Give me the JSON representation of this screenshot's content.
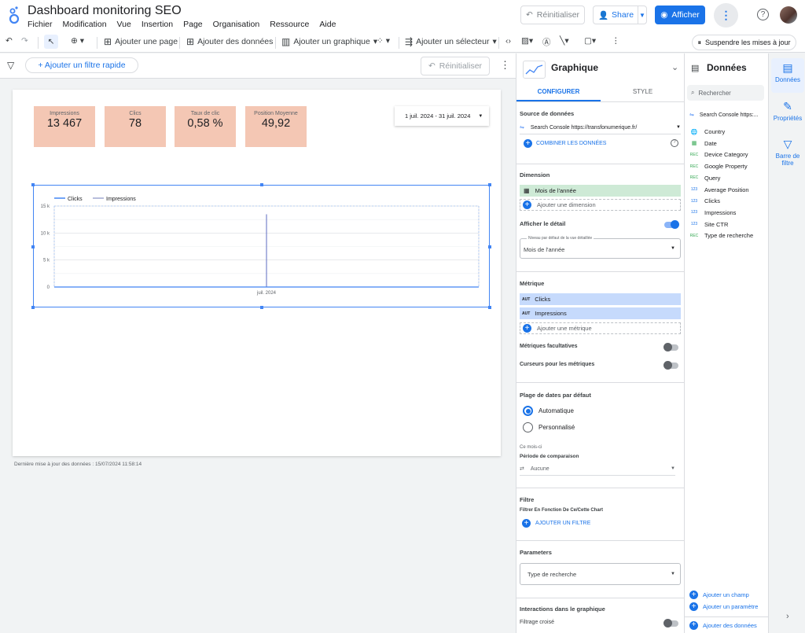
{
  "app": {
    "title": "Dashboard monitoring SEO",
    "menu": [
      "Fichier",
      "Modification",
      "Vue",
      "Insertion",
      "Page",
      "Organisation",
      "Ressource",
      "Aide"
    ]
  },
  "header": {
    "reset": "Réinitialiser",
    "share": "Share",
    "view": "Afficher"
  },
  "toolbar": {
    "add_page": "Ajouter une page",
    "add_data": "Ajouter des données",
    "add_chart": "Ajouter un graphique",
    "add_selector": "Ajouter un sélecteur",
    "pause": "Suspendre les mises à jour"
  },
  "filterbar": {
    "quick_filter": "+ Ajouter un filtre rapide",
    "reset": "Réinitialiser"
  },
  "kpis": [
    {
      "label": "Impressions",
      "value": "13 467"
    },
    {
      "label": "Clics",
      "value": "78"
    },
    {
      "label": "Taux de clic",
      "value": "0,58 %"
    },
    {
      "label": "Position Moyenne",
      "value": "49,92"
    }
  ],
  "date_range": "1 juil. 2024 - 31 juil. 2024",
  "chart_data": {
    "type": "bar",
    "categories": [
      "juil. 2024"
    ],
    "series": [
      {
        "name": "Clicks",
        "values": [
          78
        ]
      },
      {
        "name": "Impressions",
        "values": [
          13467
        ]
      }
    ],
    "yticks": [
      "15 k",
      "10 k",
      "5 k",
      "0"
    ],
    "ylim": [
      0,
      15000
    ],
    "legend": "top-left",
    "grid": true
  },
  "last_update": "Dernière mise à jour des données : 15/07/2024 11:58:14",
  "props": {
    "title": "Graphique",
    "tab_config": "CONFIGURER",
    "tab_style": "STYLE",
    "source_title": "Source de données",
    "source": "Search Console https://transfonumerique.fr/",
    "combine": "COMBINER LES DONNÉES",
    "dimension_title": "Dimension",
    "dimension": "Mois de l'année",
    "add_dimension": "Ajouter une dimension",
    "drill_title": "Afficher le détail",
    "drill_label": "Niveau par défaut de la vue détaillée",
    "drill_value": "Mois de l'année",
    "metric_title": "Métrique",
    "metrics": [
      {
        "agg": "AUT",
        "name": "Clicks"
      },
      {
        "agg": "AUT",
        "name": "Impressions"
      }
    ],
    "add_metric": "Ajouter une métrique",
    "optional_metrics": "Métriques facultatives",
    "metric_sliders": "Curseurs pour les métriques",
    "date_title": "Plage de dates par défaut",
    "auto": "Automatique",
    "custom": "Personnalisé",
    "this_month": "Ce mois-ci",
    "comparison": "Période de comparaison",
    "none": "Aucune",
    "filter_title": "Filtre",
    "filter_sub": "Filtrer En Fonction De Ce/Cette Chart",
    "add_filter": "AJOUTER UN FILTRE",
    "params_title": "Parameters",
    "param_value": "Type de recherche",
    "interactions_title": "Interactions dans le graphique",
    "cross_filter": "Filtrage croisé"
  },
  "data": {
    "title": "Données",
    "search": "Rechercher",
    "source": "Search Console https:...",
    "fields": [
      {
        "type": "geo",
        "name": "Country"
      },
      {
        "type": "date",
        "name": "Date"
      },
      {
        "type": "REC",
        "name": "Device Category"
      },
      {
        "type": "REC",
        "name": "Google Property"
      },
      {
        "type": "REC",
        "name": "Query"
      },
      {
        "type": "123",
        "name": "Average Position"
      },
      {
        "type": "123",
        "name": "Clicks"
      },
      {
        "type": "123",
        "name": "Impressions"
      },
      {
        "type": "123",
        "name": "Site CTR"
      },
      {
        "type": "REC",
        "name": "Type de recherche"
      }
    ],
    "add_field": "Ajouter un champ",
    "add_param": "Ajouter un paramètre",
    "add_data": "Ajouter des données"
  },
  "side_tabs": [
    "Données",
    "Propriétés",
    "Barre de filtre"
  ]
}
